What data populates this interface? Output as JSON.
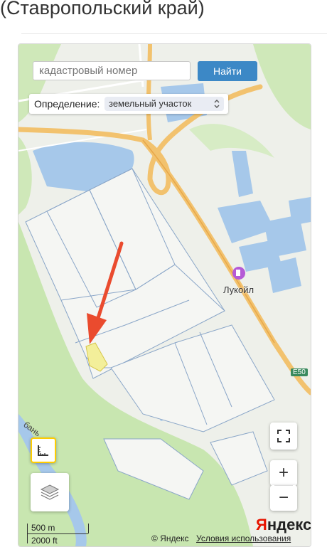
{
  "header": {
    "title": "(Ставропольский край)"
  },
  "search": {
    "placeholder": "кадастровый номер",
    "button_label": "Найти"
  },
  "definition": {
    "label": "Определение:",
    "selected": "земельный участок",
    "chevron": "⌃⌄"
  },
  "map": {
    "poi_label": "Лукойл",
    "road_label": "E50",
    "river_label": "бань",
    "zoom_in": "+",
    "zoom_out": "−",
    "scale_metric": "500 m",
    "scale_imperial": "2000 ft",
    "copyright": "© Яндекс",
    "terms": "Условия использования",
    "logo_first": "Я",
    "logo_rest": "ндекс"
  },
  "icons": [
    "ruler-icon",
    "layers-icon",
    "fullscreen-icon",
    "fuel-station-icon",
    "arrow-annotation"
  ],
  "colors": {
    "accent": "#3c88c6",
    "highway": "#f2c26e",
    "water": "#a6c8ea",
    "forest": "#c8e6b0",
    "arrow": "#ea4b2e"
  }
}
